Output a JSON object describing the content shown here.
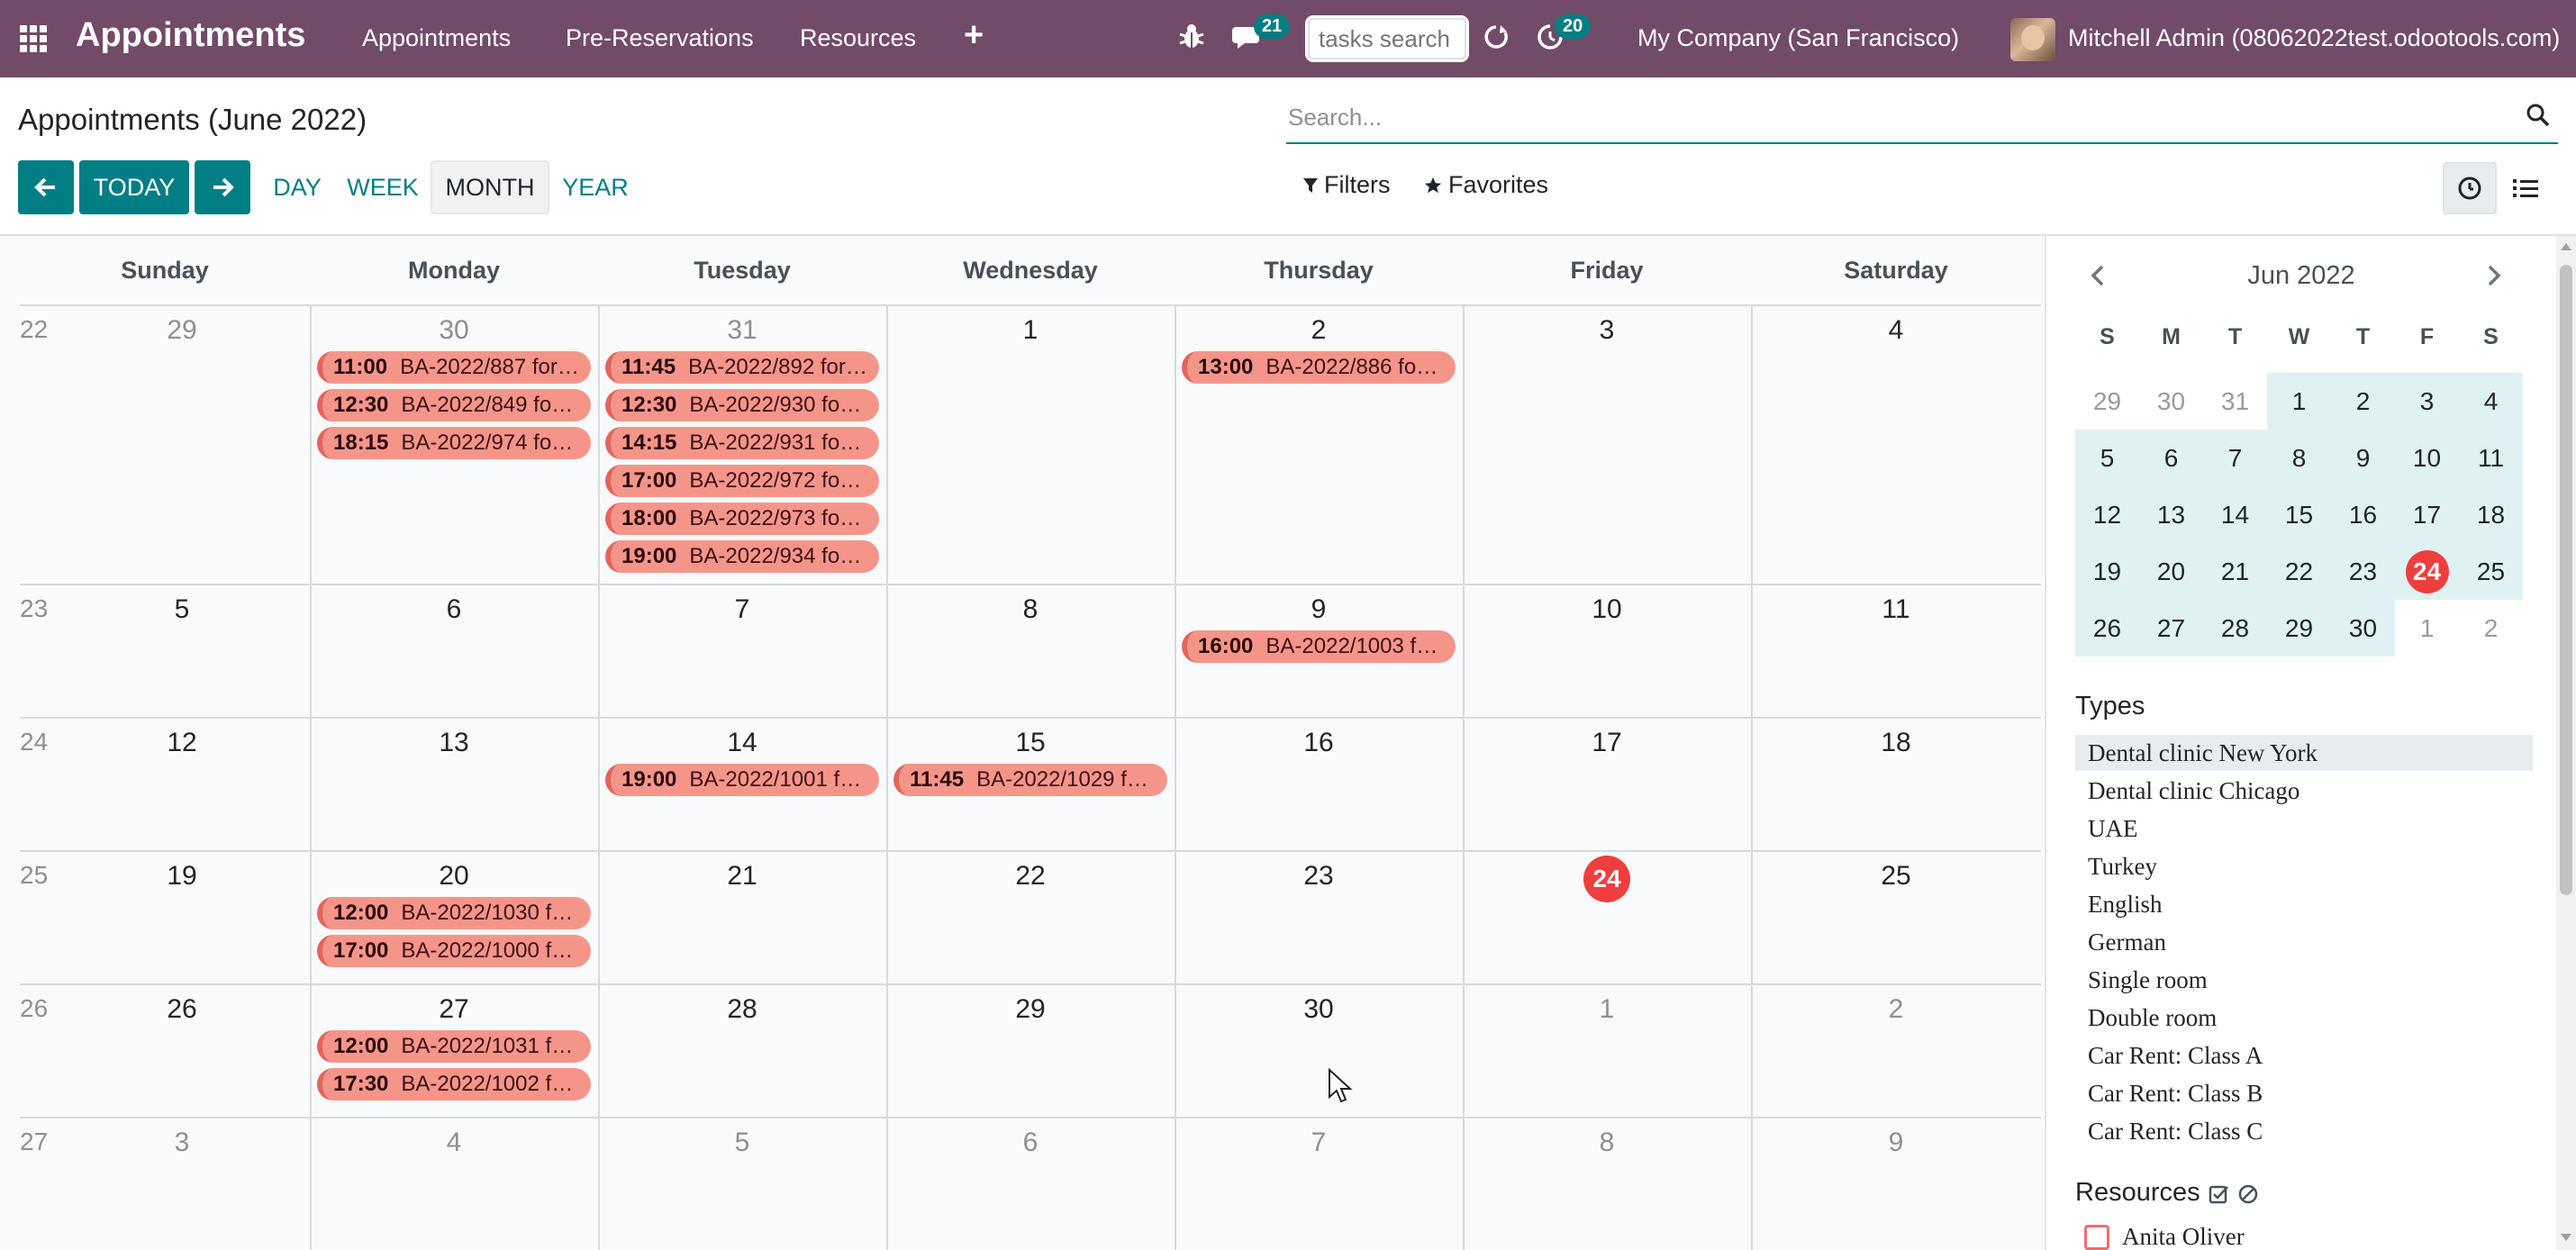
{
  "colors": {
    "navbar": "#714b67",
    "primary": "#017e84",
    "event": "#f5958a",
    "today": "#ef3e3e"
  },
  "navbar": {
    "app_title": "Appointments",
    "menu": [
      "Appointments",
      "Pre-Reservations",
      "Resources"
    ],
    "plus_label": "+",
    "messages_count": "21",
    "activities_count": "20",
    "tasks_search_placeholder": "tasks search",
    "company": "My Company (San Francisco)",
    "user": "Mitchell Admin (08062022test.odootools.com)"
  },
  "control": {
    "title": "Appointments (June 2022)",
    "search_placeholder": "Search...",
    "today_label": "TODAY",
    "scales": [
      "DAY",
      "WEEK",
      "MONTH",
      "YEAR"
    ],
    "active_scale": "MONTH",
    "filters_label": "Filters",
    "favorites_label": "Favorites"
  },
  "calendar": {
    "weekdays": [
      "Sunday",
      "Monday",
      "Tuesday",
      "Wednesday",
      "Thursday",
      "Friday",
      "Saturday"
    ],
    "today": "24",
    "weeks": [
      {
        "num": "22",
        "days": [
          "29",
          "30",
          "31",
          "1",
          "2",
          "3",
          "4"
        ],
        "other": [
          true,
          true,
          true,
          false,
          false,
          false,
          false
        ]
      },
      {
        "num": "23",
        "days": [
          "5",
          "6",
          "7",
          "8",
          "9",
          "10",
          "11"
        ],
        "other": [
          false,
          false,
          false,
          false,
          false,
          false,
          false
        ]
      },
      {
        "num": "24",
        "days": [
          "12",
          "13",
          "14",
          "15",
          "16",
          "17",
          "18"
        ],
        "other": [
          false,
          false,
          false,
          false,
          false,
          false,
          false
        ]
      },
      {
        "num": "25",
        "days": [
          "19",
          "20",
          "21",
          "22",
          "23",
          "24",
          "25"
        ],
        "other": [
          false,
          false,
          false,
          false,
          false,
          false,
          false
        ]
      },
      {
        "num": "26",
        "days": [
          "26",
          "27",
          "28",
          "29",
          "30",
          "1",
          "2"
        ],
        "other": [
          false,
          false,
          false,
          false,
          false,
          true,
          true
        ]
      },
      {
        "num": "27",
        "days": [
          "3",
          "4",
          "5",
          "6",
          "7",
          "8",
          "9"
        ],
        "other": [
          true,
          true,
          true,
          true,
          true,
          true,
          true
        ]
      }
    ],
    "events": [
      {
        "week": 0,
        "day": 1,
        "slot": 0,
        "time": "11:00",
        "title": "BA-2022/887 for ..."
      },
      {
        "week": 0,
        "day": 1,
        "slot": 1,
        "time": "12:30",
        "title": "BA-2022/849 for ..."
      },
      {
        "week": 0,
        "day": 1,
        "slot": 2,
        "time": "18:15",
        "title": "BA-2022/974 for ..."
      },
      {
        "week": 0,
        "day": 2,
        "slot": 0,
        "time": "11:45",
        "title": "BA-2022/892 for ..."
      },
      {
        "week": 0,
        "day": 2,
        "slot": 1,
        "time": "12:30",
        "title": "BA-2022/930 for ..."
      },
      {
        "week": 0,
        "day": 2,
        "slot": 2,
        "time": "14:15",
        "title": "BA-2022/931 for ..."
      },
      {
        "week": 0,
        "day": 2,
        "slot": 3,
        "time": "17:00",
        "title": "BA-2022/972 for ..."
      },
      {
        "week": 0,
        "day": 2,
        "slot": 4,
        "time": "18:00",
        "title": "BA-2022/973 for ..."
      },
      {
        "week": 0,
        "day": 2,
        "slot": 5,
        "time": "19:00",
        "title": "BA-2022/934 for ..."
      },
      {
        "week": 0,
        "day": 4,
        "slot": 0,
        "time": "13:00",
        "title": "BA-2022/886 for ..."
      },
      {
        "week": 1,
        "day": 4,
        "slot": 0,
        "time": "16:00",
        "title": "BA-2022/1003 fo..."
      },
      {
        "week": 2,
        "day": 2,
        "slot": 0,
        "time": "19:00",
        "title": "BA-2022/1001 fo..."
      },
      {
        "week": 2,
        "day": 3,
        "slot": 0,
        "time": "11:45",
        "title": "BA-2022/1029 fo..."
      },
      {
        "week": 3,
        "day": 1,
        "slot": 0,
        "time": "12:00",
        "title": "BA-2022/1030 fo..."
      },
      {
        "week": 3,
        "day": 1,
        "slot": 1,
        "time": "17:00",
        "title": "BA-2022/1000 fo..."
      },
      {
        "week": 4,
        "day": 1,
        "slot": 0,
        "time": "12:00",
        "title": "BA-2022/1031 fo..."
      },
      {
        "week": 4,
        "day": 1,
        "slot": 1,
        "time": "17:30",
        "title": "BA-2022/1002 fo..."
      }
    ]
  },
  "sidepanel": {
    "mini_month": "Jun 2022",
    "mini_weekdays": [
      "S",
      "M",
      "T",
      "W",
      "T",
      "F",
      "S"
    ],
    "mini_weeks": [
      [
        "29",
        "30",
        "31",
        "1",
        "2",
        "3",
        "4"
      ],
      [
        "5",
        "6",
        "7",
        "8",
        "9",
        "10",
        "11"
      ],
      [
        "12",
        "13",
        "14",
        "15",
        "16",
        "17",
        "18"
      ],
      [
        "19",
        "20",
        "21",
        "22",
        "23",
        "24",
        "25"
      ],
      [
        "26",
        "27",
        "28",
        "29",
        "30",
        "1",
        "2"
      ]
    ],
    "types_title": "Types",
    "types": [
      "Dental clinic New York",
      "Dental clinic Chicago",
      "UAE",
      "Turkey",
      "English",
      "German",
      "Single room",
      "Double room",
      "Car Rent: Class A",
      "Car Rent: Class B",
      "Car Rent: Class C"
    ],
    "selected_type": "Dental clinic New York",
    "resources_title": "Resources",
    "resources": [
      "Anita Oliver"
    ]
  }
}
